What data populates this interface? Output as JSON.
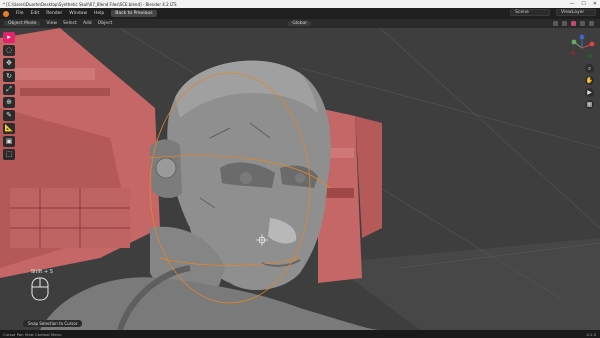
{
  "window": {
    "title": "* [C:\\Users\\Duarte\\Desktop\\Synthetic Skull\\07_Blend Files\\SCE.blend] - Blender 4.2 LTS",
    "minimize": "—",
    "maximize": "☐",
    "close": "✕"
  },
  "menubar": {
    "items": [
      "File",
      "Edit",
      "Render",
      "Window",
      "Help"
    ],
    "back_button": "Back to Previous",
    "scene_label": "Scene",
    "view_layer_label": "ViewLayer"
  },
  "header": {
    "mode": "Object Mode",
    "items": [
      "View",
      "Select",
      "Add",
      "Object"
    ],
    "orientation": "Global"
  },
  "toolbar": {
    "tools": [
      "cursor",
      "select-box",
      "move",
      "rotate",
      "scale",
      "transform",
      "annotate",
      "measure",
      "add-cube",
      "add-object"
    ]
  },
  "viewport": {
    "shortcut_hint": "Shift + S"
  },
  "status": {
    "pill": "Snap Selection to Cursor",
    "footer_left": "Cursor   Pan View   Context Menu",
    "version": "4.2.0"
  },
  "colors": {
    "accent": "#e0246a",
    "scifi_panel": "#c96b6b",
    "sculpt_gray": "#8e8e8e",
    "selection_outline": "#e0862a"
  }
}
